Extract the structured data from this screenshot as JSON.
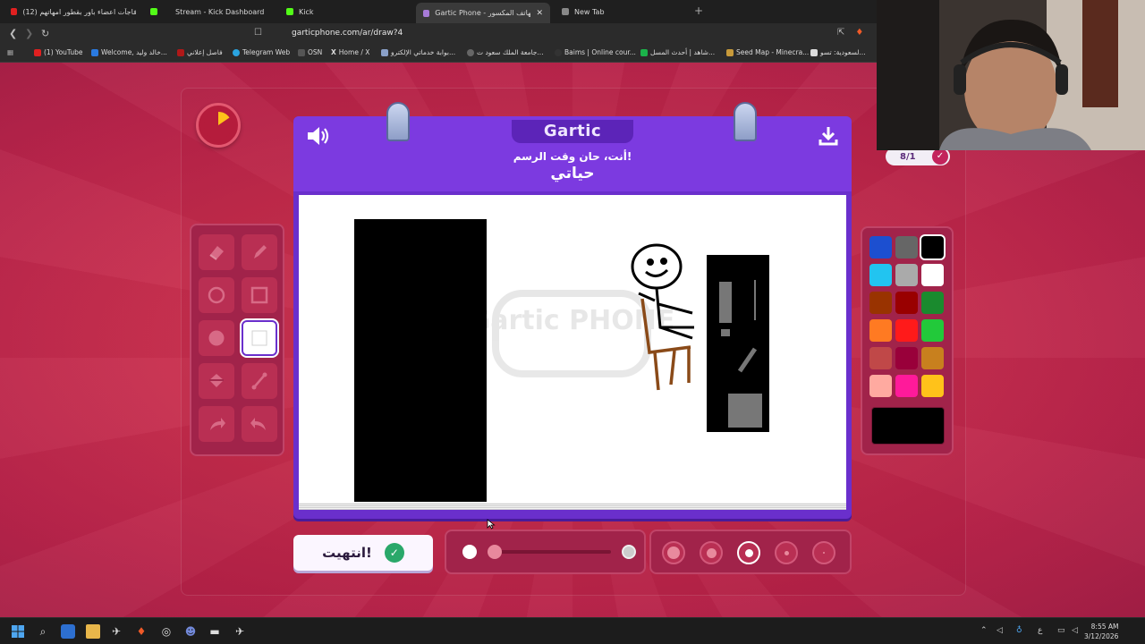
{
  "browser": {
    "tabs": [
      {
        "title": "(12) فاجآت اعضاء باور بقطور امهاتهم",
        "fav": "#e02020"
      },
      {
        "title": "Stream - Kick Dashboard",
        "fav": "#53fc18"
      },
      {
        "title": "Kick",
        "fav": "#53fc18"
      },
      {
        "title": "Gartic Phone - الهاتف المكسور",
        "fav": "#a77bd8"
      },
      {
        "title": "New Tab",
        "fav": "#888888"
      }
    ],
    "url": "garticphone.com/ar/draw?4",
    "bookmarks": [
      "(1) YouTube",
      "Welcome, خالد وليد...",
      "فاصل إعلاني",
      "Telegram Web",
      "OSN",
      "Home / X",
      "بوابة خدماتي الإلكترو...",
      "جامعة الملك سعود ت...",
      "Baims | Online cour...",
      "شاهد | أحدث المسل...",
      "Seed Map - Minecra...",
      "لسعودية: تسو..."
    ]
  },
  "game": {
    "logo": "Gartic",
    "prompt": "أنت، حان وقت الرسم!",
    "word": "حياتي",
    "counter": "8/1",
    "done_label": "انتهيت!",
    "canvas_watermark": "Gartic PHONE",
    "tools": [
      {
        "name": "eraser-tool-icon",
        "active": false
      },
      {
        "name": "pencil-tool-icon",
        "active": false
      },
      {
        "name": "ellipse-outline-tool-icon",
        "active": false
      },
      {
        "name": "rectangle-outline-tool-icon",
        "active": false
      },
      {
        "name": "ellipse-filled-tool-icon",
        "active": false
      },
      {
        "name": "rectangle-filled-tool-icon",
        "active": true
      },
      {
        "name": "fill-bucket-tool-icon",
        "active": false
      },
      {
        "name": "line-tool-icon",
        "active": false
      },
      {
        "name": "undo-icon",
        "active": false
      },
      {
        "name": "redo-icon",
        "active": false
      }
    ],
    "palette": [
      "#1c4fd0",
      "#666666",
      "#000000",
      "#22c4f0",
      "#aaaaaa",
      "#ffffff",
      "#993300",
      "#990000",
      "#1a8a2e",
      "#ff7a22",
      "#ff1a1a",
      "#22c93a",
      "#c04848",
      "#99003a",
      "#c8801e",
      "#ffaaa0",
      "#ff1a9a",
      "#ffc21a"
    ],
    "selected_color": "#000000",
    "opacity_level": 0.0,
    "selected_brush_size_index": 2
  },
  "system": {
    "time": "8:55 AM",
    "date": "3/12/2026",
    "lang": "ع"
  }
}
